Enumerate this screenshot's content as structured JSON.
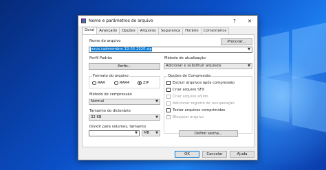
{
  "window": {
    "title": "Nome e parâmetros do arquivo",
    "help_glyph": "?",
    "close_glyph": "✕"
  },
  "tabs": [
    {
      "label": "Geral",
      "active": true
    },
    {
      "label": "Avançado"
    },
    {
      "label": "Opções"
    },
    {
      "label": "Arquivos"
    },
    {
      "label": "Segurança"
    },
    {
      "label": "Horário"
    },
    {
      "label": "Comentários"
    }
  ],
  "general": {
    "archive_name_label": "Nome do arquivo",
    "browse_label": "Procurar...",
    "archive_name_value": "nova-cadmembro-19-03-2020.zip",
    "profile_label": "Perfil Padrão",
    "profiles_button": "Perfis...",
    "update_method_label": "Método de atualização",
    "update_method_value": "Adicionar e substituir arquivos",
    "format_label": "Formato do arquivo",
    "formats": [
      {
        "label": "RAR",
        "selected": false
      },
      {
        "label": "RAR4",
        "selected": false
      },
      {
        "label": "ZIP",
        "selected": true
      }
    ],
    "compression_method_label": "Método de compressão",
    "compression_method_value": "Normal",
    "dictionary_label": "Tamanho do dicionário",
    "dictionary_value": "32 KB",
    "split_label": "Dividir para volumes, tamanho",
    "split_value": "",
    "split_unit": "MB",
    "compression_options_label": "Opções de Compressão",
    "options": [
      {
        "label": "Excluir arquivos após compressão",
        "enabled": true,
        "checked": false
      },
      {
        "label": "Criar arquivo SFX",
        "enabled": true,
        "checked": false
      },
      {
        "label": "Criar arquivo sólido",
        "enabled": false,
        "checked": false
      },
      {
        "label": "Adicionar registro de recuperação",
        "enabled": false,
        "checked": false
      },
      {
        "label": "Testar arquivos comprimidos",
        "enabled": true,
        "checked": false
      },
      {
        "label": "Bloquear arquivo",
        "enabled": false,
        "checked": false
      }
    ],
    "password_button": "Definir senha..."
  },
  "buttons": {
    "ok": "OK",
    "cancel": "Cancelar",
    "help": "Ajuda"
  },
  "colors": {
    "selection": "#0078d7",
    "dialog_bg": "#f0f0f0"
  }
}
